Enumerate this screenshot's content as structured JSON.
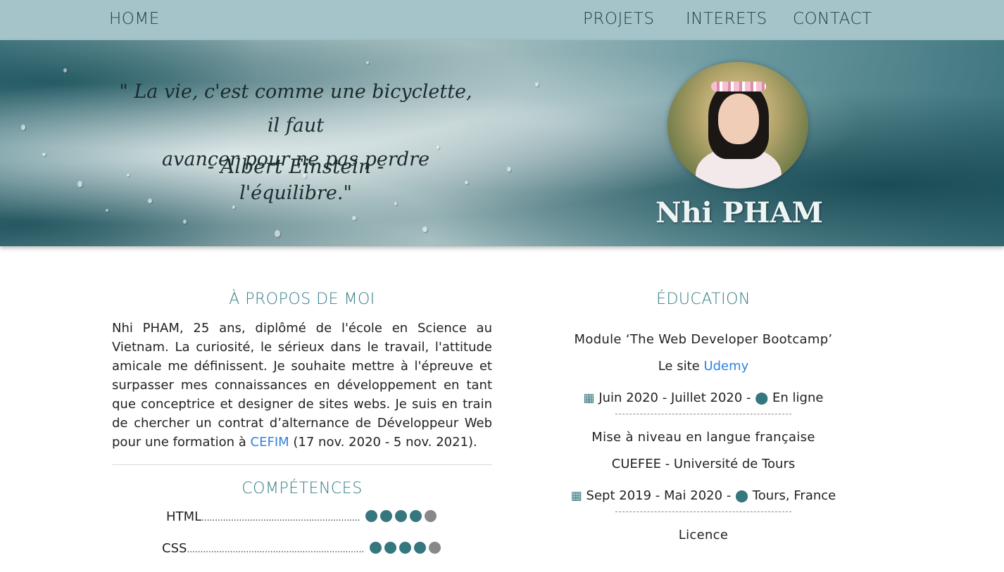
{
  "nav": {
    "home": "HOME",
    "projets": "PROJETS",
    "interets": "INTERETS",
    "contact": "CONTACT"
  },
  "hero": {
    "quote_line1": "\" La vie, c'est comme une bicyclette, il faut",
    "quote_line2": "avancer pour ne pas perdre l'équilibre.\"",
    "author": "- Albert Einstein -",
    "name": "Nhi PHAM"
  },
  "about": {
    "title": "À PROPOS DE MOI",
    "text_before": "Nhi PHAM, 25 ans, diplômé de l'école en Science au Vietnam. La curiosité, le sérieux dans le travail, l'attitude amicale me définissent. Je souhaite mettre à l'épreuve et surpasser mes connaissances en développement en tant que conceptrice et designer de sites webs. Je suis en train de chercher un contrat d’alternance de Développeur Web pour une formation à ",
    "link": "CEFIM",
    "text_after": " (17 nov. 2020 - 5 nov. 2021)."
  },
  "skills": {
    "title": "COMPÉTENCES",
    "items": [
      {
        "name": "HTML",
        "dots": "...........................................................",
        "level": 4,
        "max": 5
      },
      {
        "name": "CSS",
        "dots": "..................................................................",
        "level": 4,
        "max": 5
      }
    ]
  },
  "education": {
    "title": "ÉDUCATION",
    "entries": [
      {
        "title": "Module ‘The Web Developer Bootcamp’",
        "school_prefix": "Le site ",
        "school_link": "Udemy",
        "dates": "Juin 2020 - Juillet 2020 - ",
        "location": "En ligne"
      },
      {
        "title": "Mise à niveau en langue française",
        "school_prefix": "CUEFEE - Université de Tours",
        "school_link": "",
        "dates": "Sept 2019 - Mai 2020 - ",
        "location": "Tours, France"
      },
      {
        "title": "Licence"
      }
    ]
  },
  "icons": {
    "calendar": "calendar-icon",
    "location": "map-marker-icon"
  },
  "colors": {
    "nav_bg": "#a4c4ca",
    "accent": "#337c85",
    "link": "#2f82e0",
    "dot_on": "#35767f",
    "dot_off": "#888888"
  }
}
